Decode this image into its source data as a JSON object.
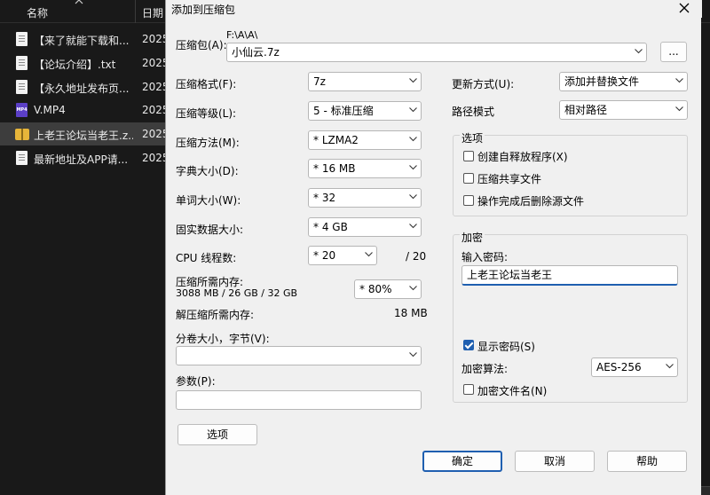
{
  "explorer": {
    "col_name": "名称",
    "col_date": "日期",
    "files": [
      {
        "name": "【来了就能下载和...",
        "date": "2025",
        "icon": "document-icon"
      },
      {
        "name": "【论坛介绍】.txt",
        "date": "2025",
        "icon": "document-icon"
      },
      {
        "name": "【永久地址发布页...",
        "date": "2025",
        "icon": "document-icon"
      },
      {
        "name": "V.MP4",
        "date": "2025",
        "icon": "video-icon"
      },
      {
        "name": "上老王论坛当老王.z...",
        "date": "2025",
        "icon": "zip-folder-icon"
      },
      {
        "name": "最新地址及APP请...",
        "date": "2025",
        "icon": "document-icon"
      }
    ]
  },
  "dialog": {
    "title": "添加到压缩包",
    "close": "✕",
    "archive_label": "压缩包(A):",
    "archive_path": "F:\\A\\A\\",
    "archive_name": "小仙云.7z",
    "browse": "...",
    "format_label": "压缩格式(F):",
    "format_value": "7z",
    "level_label": "压缩等级(L):",
    "level_value": "5 - 标准压缩",
    "method_label": "压缩方法(M):",
    "method_value": "* LZMA2",
    "dict_label": "字典大小(D):",
    "dict_value": "* 16 MB",
    "word_label": "单词大小(W):",
    "word_value": "* 32",
    "solid_label": "固实数据大小:",
    "solid_value": "* 4 GB",
    "threads_label": "CPU 线程数:",
    "threads_value": "* 20",
    "threads_total": "/ 20",
    "mem_comp_label": "压缩所需内存:",
    "mem_comp_detail": "3088 MB / 26 GB / 32 GB",
    "mem_comp_value": "* 80%",
    "mem_decomp_label": "解压缩所需内存:",
    "mem_decomp_value": "18 MB",
    "volume_label": "分卷大小，字节(V):",
    "volume_value": "",
    "params_label": "参数(P):",
    "params_value": "",
    "options_button": "选项",
    "update_label": "更新方式(U):",
    "update_value": "添加并替换文件",
    "path_label": "路径模式",
    "path_value": "相对路径",
    "options_group": "选项",
    "opt_sfx": "创建自释放程序(X)",
    "opt_shared": "压缩共享文件",
    "opt_delete": "操作完成后删除源文件",
    "enc_group": "加密",
    "enc_password_label": "输入密码:",
    "enc_password_value": "上老王论坛当老王",
    "enc_show_password": "显示密码(S)",
    "enc_method_label": "加密算法:",
    "enc_method_value": "AES-256",
    "enc_filenames": "加密文件名(N)",
    "ok": "确定",
    "cancel": "取消",
    "help": "帮助"
  },
  "colors": {
    "accent": "#1f5fb0",
    "dialog_bg": "#f0f0f0",
    "explorer_bg": "#191919"
  }
}
